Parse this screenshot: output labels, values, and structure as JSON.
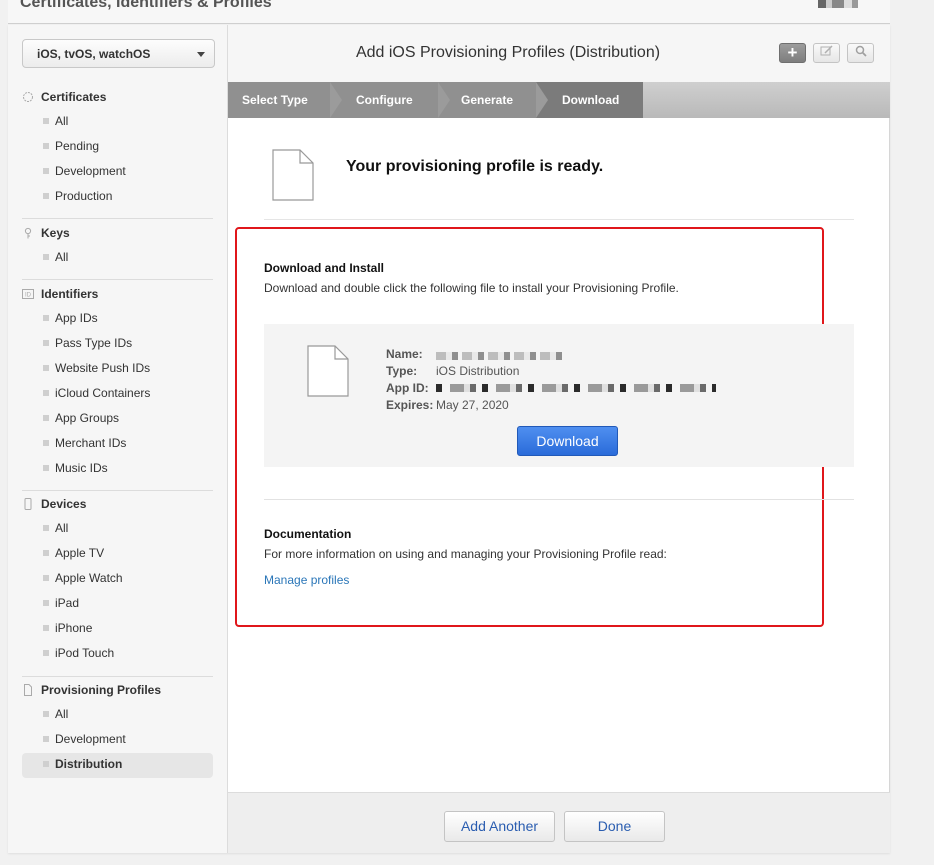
{
  "top": {
    "title": "Certificates, Identifiers & Profiles"
  },
  "sidebar": {
    "platform": "iOS, tvOS, watchOS",
    "sections": [
      {
        "title": "Certificates",
        "icon": "certificate-icon",
        "items": [
          "All",
          "Pending",
          "Development",
          "Production"
        ]
      },
      {
        "title": "Keys",
        "icon": "key-icon",
        "items": [
          "All"
        ]
      },
      {
        "title": "Identifiers",
        "icon": "id-icon",
        "items": [
          "App IDs",
          "Pass Type IDs",
          "Website Push IDs",
          "iCloud Containers",
          "App Groups",
          "Merchant IDs",
          "Music IDs"
        ]
      },
      {
        "title": "Devices",
        "icon": "device-icon",
        "items": [
          "All",
          "Apple TV",
          "Apple Watch",
          "iPad",
          "iPhone",
          "iPod Touch"
        ]
      },
      {
        "title": "Provisioning Profiles",
        "icon": "document-icon",
        "items": [
          "All",
          "Development",
          "Distribution"
        ],
        "active": "Distribution"
      }
    ]
  },
  "header": {
    "title": "Add iOS Provisioning Profiles (Distribution)",
    "add_label": "+"
  },
  "steps": [
    "Select Type",
    "Configure",
    "Generate",
    "Download"
  ],
  "ready": {
    "message": "Your provisioning profile is ready."
  },
  "download_install": {
    "title": "Download and Install",
    "description": "Download and double click the following file to install your Provisioning Profile.",
    "labels": {
      "name": "Name:",
      "type": "Type:",
      "app_id": "App ID:",
      "expires": "Expires:"
    },
    "type_value": "iOS Distribution",
    "expires_value": "May 27, 2020",
    "button": "Download"
  },
  "documentation": {
    "title": "Documentation",
    "description": "For more information on using and managing your Provisioning Profile read:",
    "link": "Manage profiles"
  },
  "footer": {
    "add_another": "Add Another",
    "done": "Done"
  },
  "colors": {
    "highlight": "#e0171b",
    "primary_button": "#2a6bd9",
    "link": "#2a76b8"
  }
}
